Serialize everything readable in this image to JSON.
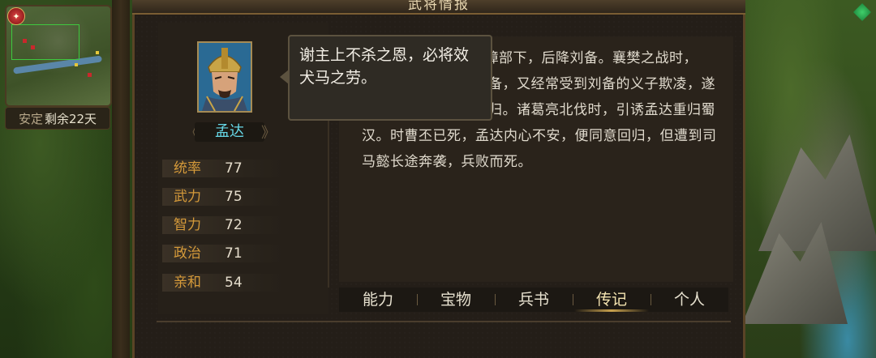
{
  "window": {
    "title": "武将情报"
  },
  "minimap": {
    "status_label": "安定",
    "status_value": "剩余22天"
  },
  "general": {
    "name": "孟达",
    "stats": [
      {
        "label": "统率",
        "value": "77"
      },
      {
        "label": "武力",
        "value": "75"
      },
      {
        "label": "智力",
        "value": "72"
      },
      {
        "label": "政治",
        "value": "71"
      },
      {
        "label": "亲和",
        "value": "54"
      }
    ]
  },
  "tooltip": {
    "text": "谢主上不杀之恩，必将效犬马之劳。"
  },
  "biography": {
    "lines": [
      "刘璋部下，后降刘备。襄樊之战时，",
      "备，又经常受到刘备的义子欺凌，遂",
      "归。诸葛亮北伐时，引诱孟达重归蜀",
      "汉。时曹丕已死，孟达内心不安，便同意回归，但遭到司",
      "马懿长途奔袭，兵败而死。"
    ]
  },
  "tabs": [
    {
      "label": "能力"
    },
    {
      "label": "宝物"
    },
    {
      "label": "兵书"
    },
    {
      "label": "传记"
    },
    {
      "label": "个人"
    }
  ],
  "active_tab": "传记",
  "icons": {
    "minimap_badge": "warning-badge-icon",
    "corner": "green-gem-icon",
    "nav_prev": "chevron-left-icon",
    "nav_next": "chevron-right-icon"
  },
  "colors": {
    "stat_label": "#d59a3a",
    "name": "#67d8e8",
    "panel": "#241e18"
  }
}
